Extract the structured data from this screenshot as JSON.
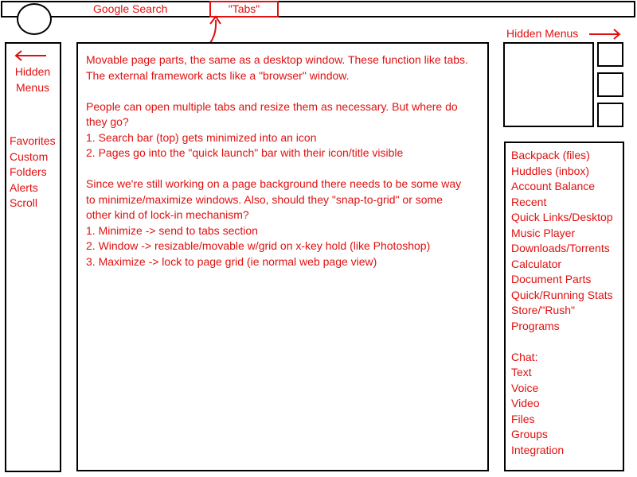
{
  "header": {
    "search_label": "Google Search",
    "tabs_label": "\"Tabs\""
  },
  "left_sidebar": {
    "hidden_menus_label": "Hidden Menus",
    "items": [
      "Favorites",
      "Custom",
      "Folders",
      "Alerts",
      "Scroll"
    ]
  },
  "main": {
    "paragraphs": [
      {
        "lines": [
          "Movable page parts, the same as a desktop window. These function like tabs.",
          "The external framework acts like a \"browser\" window."
        ]
      },
      {
        "lines": [
          "People can open multiple tabs and resize them as necessary. But where do",
          "they go?",
          "1. Search bar (top) gets minimized into an icon",
          "2. Pages go into the \"quick launch\" bar with their icon/title visible"
        ]
      },
      {
        "lines": [
          "Since we're still working on a page background there needs to be some way",
          "to minimize/maximize windows. Also, should they \"snap-to-grid\" or some",
          "other kind of lock-in mechanism?",
          "1. Minimize -> send to tabs section",
          "2. Window  -> resizable/movable w/grid on x-key hold (like Photoshop)",
          "3. Maximize -> lock to page grid (ie normal web page view)"
        ]
      }
    ]
  },
  "right_sidebar": {
    "hidden_menus_label": "Hidden Menus",
    "menu_items": [
      "Backpack (files)",
      "Huddles (inbox)",
      "Account Balance",
      "Recent",
      "Quick Links/Desktop",
      "Music Player",
      "Downloads/Torrents",
      "Calculator",
      "Document Parts",
      "Quick/Running Stats",
      "Store/\"Rush\"",
      "Programs"
    ],
    "chat_header": "Chat:",
    "chat_items": [
      "Text",
      "Voice",
      "Video",
      "Files",
      "Groups",
      "Integration"
    ]
  },
  "colors": {
    "annotation": "#e01010",
    "outline": "#000000",
    "background": "#ffffff"
  },
  "icons": {
    "logo": "logo-circle",
    "left_arrow": "arrow-left-icon",
    "right_arrow": "arrow-right-icon",
    "tabs_pointer": "curved-arrow-icon"
  }
}
